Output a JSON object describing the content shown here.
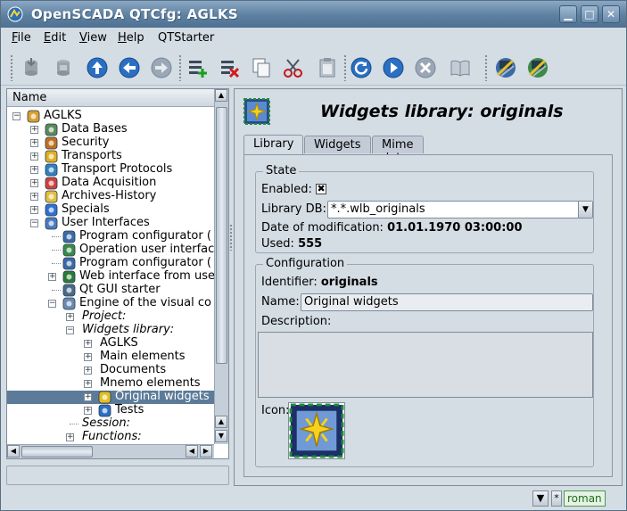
{
  "window": {
    "title": "OpenSCADA QTCfg: AGLKS",
    "buttons": {
      "minimize": "▁",
      "maximize": "□",
      "close": "✕"
    }
  },
  "menubar": {
    "items": [
      {
        "label": "File",
        "accel": "F",
        "rest": "ile"
      },
      {
        "label": "Edit",
        "accel": "E",
        "rest": "dit"
      },
      {
        "label": "View",
        "accel": "V",
        "rest": "iew"
      },
      {
        "label": "Help",
        "accel": "H",
        "rest": "elp"
      },
      {
        "label": "QTStarter",
        "accel": "",
        "rest": "QTStarter"
      }
    ]
  },
  "toolbar": {
    "icons": [
      "db-load-icon",
      "db-save-icon",
      "up-icon",
      "back-icon",
      "forward-icon",
      "add-item-icon",
      "delete-item-icon",
      "copy-icon",
      "cut-icon",
      "paste-icon",
      "refresh-icon",
      "start-icon",
      "stop-icon",
      "manual-icon",
      "program-config-icon",
      "visual-config-icon"
    ]
  },
  "tree": {
    "header": "Name",
    "items": [
      {
        "label": "AGLKS",
        "level": 0,
        "exp": "−",
        "icon": "station-icon",
        "italic": false
      },
      {
        "label": "Data Bases",
        "level": 1,
        "exp": "+",
        "icon": "database-icon",
        "italic": false
      },
      {
        "label": "Security",
        "level": 1,
        "exp": "+",
        "icon": "security-icon",
        "italic": false
      },
      {
        "label": "Transports",
        "level": 1,
        "exp": "+",
        "icon": "transport-icon",
        "italic": false
      },
      {
        "label": "Transport Protocols",
        "level": 1,
        "exp": "+",
        "icon": "protocol-icon",
        "italic": false
      },
      {
        "label": "Data Acquisition",
        "level": 1,
        "exp": "+",
        "icon": "daq-icon",
        "italic": false
      },
      {
        "label": "Archives-History",
        "level": 1,
        "exp": "+",
        "icon": "archive-icon",
        "italic": false
      },
      {
        "label": "Specials",
        "level": 1,
        "exp": "+",
        "icon": "specials-icon",
        "italic": false
      },
      {
        "label": "User Interfaces",
        "level": 1,
        "exp": "−",
        "icon": "ui-icon",
        "italic": false
      },
      {
        "label": "Program configurator (",
        "level": 2,
        "exp": "",
        "icon": "program-config-icon",
        "italic": false
      },
      {
        "label": "Operation user interfac",
        "level": 2,
        "exp": "",
        "icon": "operation-ui-icon",
        "italic": false
      },
      {
        "label": "Program configurator (",
        "level": 2,
        "exp": "",
        "icon": "program-config-icon",
        "italic": false
      },
      {
        "label": "Web interface from use",
        "level": 2,
        "exp": "+",
        "icon": "web-ui-icon",
        "italic": false
      },
      {
        "label": "Qt GUI starter",
        "level": 2,
        "exp": "",
        "icon": "qt-starter-icon",
        "italic": false
      },
      {
        "label": "Engine of the visual co",
        "level": 2,
        "exp": "−",
        "icon": "vis-engine-icon",
        "italic": false
      },
      {
        "label": "Project:",
        "level": 3,
        "exp": "+",
        "icon": "",
        "italic": true
      },
      {
        "label": "Widgets library:",
        "level": 3,
        "exp": "−",
        "icon": "",
        "italic": true
      },
      {
        "label": "AGLKS",
        "level": 4,
        "exp": "+",
        "icon": "",
        "italic": false
      },
      {
        "label": "Main elements",
        "level": 4,
        "exp": "+",
        "icon": "",
        "italic": false
      },
      {
        "label": "Documents",
        "level": 4,
        "exp": "+",
        "icon": "",
        "italic": false
      },
      {
        "label": "Mnemo elements",
        "level": 4,
        "exp": "+",
        "icon": "",
        "italic": false
      },
      {
        "label": "Original widgets",
        "level": 4,
        "exp": "+",
        "icon": "original-widgets-icon",
        "italic": false,
        "selected": true
      },
      {
        "label": "Tests",
        "level": 4,
        "exp": "+",
        "icon": "tests-icon",
        "italic": false
      },
      {
        "label": "Session:",
        "level": 3,
        "exp": "",
        "icon": "",
        "italic": true
      },
      {
        "label": "Functions:",
        "level": 3,
        "exp": "+",
        "icon": "",
        "italic": true
      }
    ]
  },
  "page": {
    "title": "Widgets library: originals",
    "tabs": [
      "Library",
      "Widgets",
      "Mime data"
    ],
    "state": {
      "group_title": "State",
      "enabled_label": "Enabled:",
      "enabled_mark": "✖",
      "library_db_label": "Library DB:",
      "library_db_value": "*.*.wlb_originals",
      "date_label": "Date of modification:",
      "date_value": "01.01.1970 03:00:00",
      "used_label": "Used:",
      "used_value": "555"
    },
    "config": {
      "group_title": "Configuration",
      "identifier_label": "Identifier:",
      "identifier_value": "originals",
      "name_label": "Name:",
      "name_value": "Original widgets",
      "description_label": "Description:",
      "icon_label": "Icon:"
    }
  },
  "statusbar": {
    "menu_button": "▼",
    "modified_mark": "*",
    "user": "roman"
  }
}
